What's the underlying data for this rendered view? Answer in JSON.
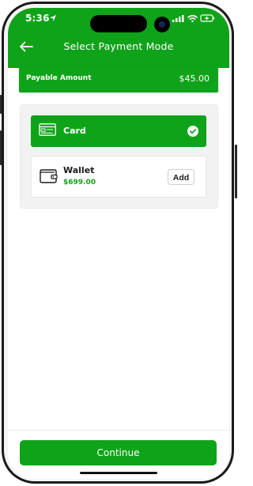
{
  "status_bar": {
    "time": "5:36"
  },
  "header": {
    "title": "Select Payment Mode"
  },
  "payable": {
    "label": "Payable Amount",
    "amount": "$45.00"
  },
  "payment_options": {
    "card": {
      "label": "Card",
      "selected": true
    },
    "wallet": {
      "label": "Wallet",
      "balance": "$699.00",
      "add_label": "Add"
    }
  },
  "footer": {
    "continue_label": "Continue"
  },
  "colors": {
    "accent": "#0fa319",
    "panel": "#f2f2f2"
  }
}
